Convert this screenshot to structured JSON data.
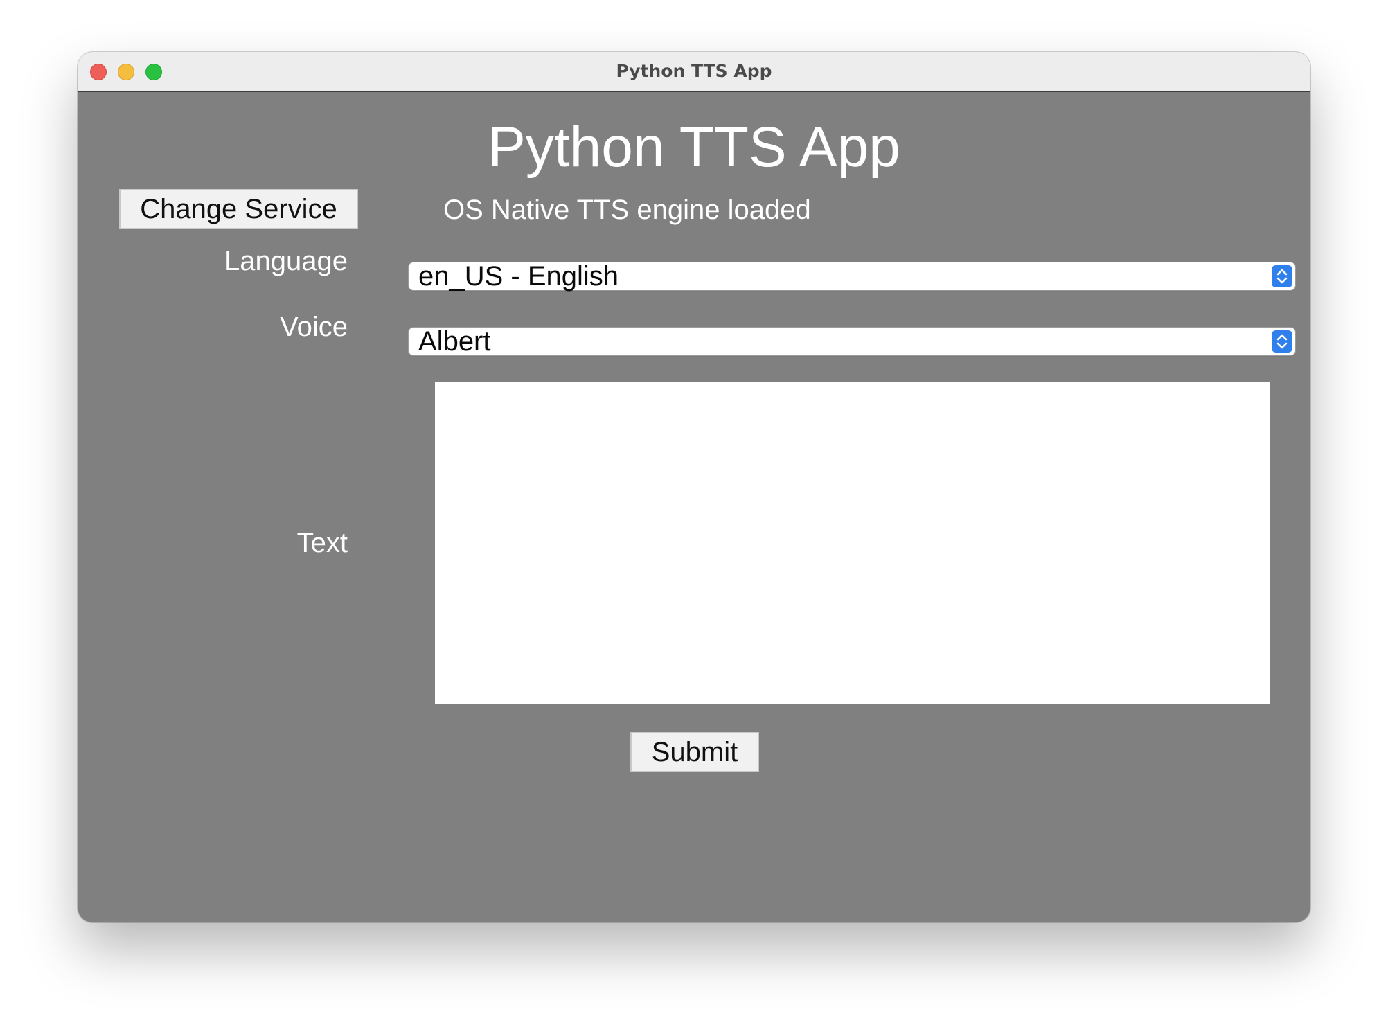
{
  "window": {
    "title": "Python TTS App"
  },
  "app": {
    "heading": "Python TTS App",
    "change_service_label": "Change Service",
    "status_text": "OS Native TTS engine loaded",
    "language_label": "Language",
    "language_selected": "en_US - English",
    "voice_label": "Voice",
    "voice_selected": "Albert",
    "text_label": "Text",
    "text_value": "",
    "submit_label": "Submit"
  },
  "colors": {
    "window_background": "#808080",
    "titlebar": "#eeeded",
    "select_accent": "#2f80ed",
    "close": "#ed5f58",
    "minimize": "#f5be3f",
    "maximize": "#29c13f"
  }
}
